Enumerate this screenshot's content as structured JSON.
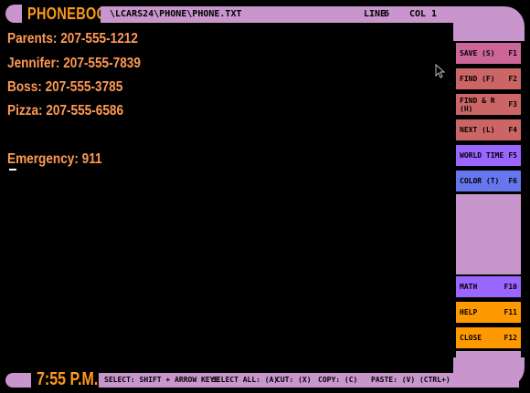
{
  "header": {
    "app_title": "PHONEBOOK",
    "file_path": "\\LCARS24\\PHONE\\PHONE.TXT",
    "line_label": "LINE",
    "line_value": "6",
    "col_label": "COL",
    "col_value": "1"
  },
  "editor": {
    "lines": [
      "Parents: 207-555-1212",
      "Jennifer: 207-555-7839",
      "Boss: 207-555-3785",
      "Pizza: 207-555-6586",
      "",
      "Emergency: 911"
    ]
  },
  "function_keys": [
    {
      "label": "SAVE (S)",
      "key": "F1",
      "color": "#cc6699"
    },
    {
      "label": "FIND (F)",
      "key": "F2",
      "color": "#cc6666"
    },
    {
      "label": "FIND & R (H)",
      "key": "F3",
      "color": "#cc6666"
    },
    {
      "label": "NEXT (L)",
      "key": "F4",
      "color": "#cc6666"
    },
    {
      "label": "WORLD TIME",
      "key": "F5",
      "color": "#9966ff"
    },
    {
      "label": "COLOR (T)",
      "key": "F6",
      "color": "#6677ee"
    },
    {
      "label": "MATH",
      "key": "F10",
      "color": "#9966ff"
    },
    {
      "label": "HELP",
      "key": "F11",
      "color": "#ff9900"
    },
    {
      "label": "CLOSE",
      "key": "F12",
      "color": "#ff9900"
    }
  ],
  "footer": {
    "clock": "7:55 P.M.",
    "select_hint": "SELECT: SHIFT + ARROW KEYS",
    "select_all_hint": "SELECT ALL: (A)",
    "cut_hint": "CUT: (X)",
    "copy_hint": "COPY: (C)",
    "paste_hint": "PASTE: (V) (CTRL+)"
  },
  "colors": {
    "frame": "#c896cc",
    "title_text": "#ff9a1a",
    "editor_text": "#ff9a55",
    "background": "#000000"
  }
}
